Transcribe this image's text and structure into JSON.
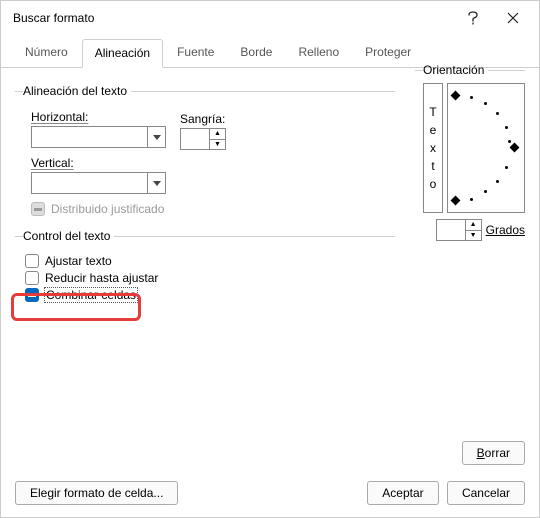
{
  "title": "Buscar formato",
  "tabs": {
    "numero": "Número",
    "alineacion": "Alineación",
    "fuente": "Fuente",
    "borde": "Borde",
    "relleno": "Relleno",
    "proteger": "Proteger"
  },
  "groups": {
    "text_align": "Alineación del texto",
    "text_control": "Control del texto",
    "orientation": "Orientación"
  },
  "labels": {
    "horizontal": "Horizontal:",
    "vertical": "Vertical:",
    "sangria": "Sangría:",
    "dist_just": "Distribuido justificado",
    "wrap": "Ajustar texto",
    "shrink": "Reducir hasta ajustar",
    "merge": "Combinar celdas",
    "grados": "Grados",
    "vtext": "Texto"
  },
  "values": {
    "horizontal": "",
    "vertical": "",
    "sangria": "",
    "grados": ""
  },
  "buttons": {
    "borrar": "Borrar",
    "aceptar": "Aceptar",
    "cancelar": "Cancelar",
    "elegir": "Elegir formato de celda..."
  }
}
